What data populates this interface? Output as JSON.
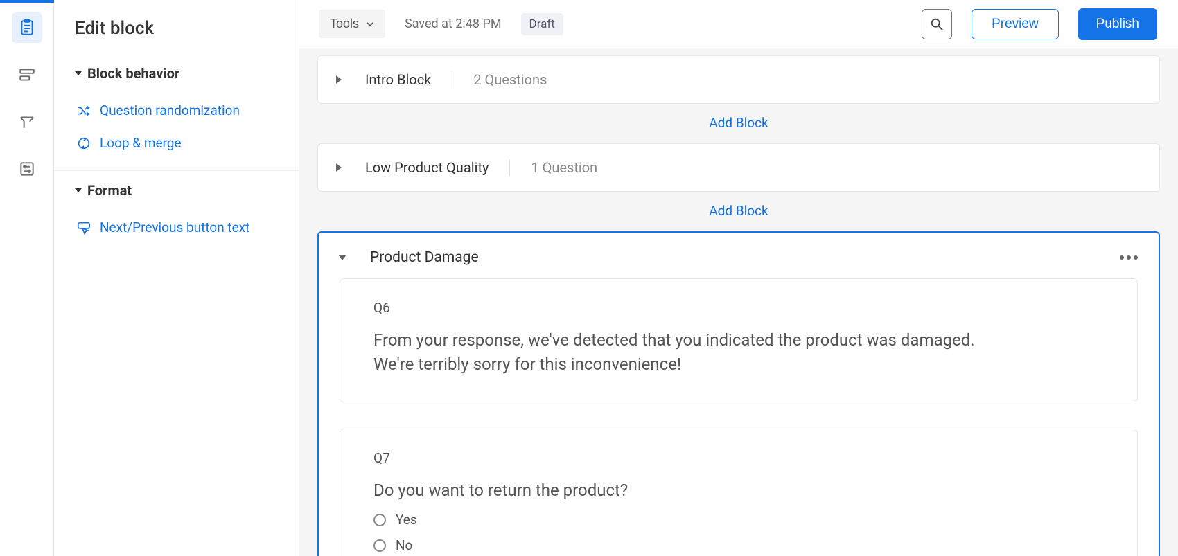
{
  "sidebar": {
    "title": "Edit block",
    "section_behavior": "Block behavior",
    "link_randomization": "Question randomization",
    "link_loopmerge": "Loop & merge",
    "section_format": "Format",
    "link_nav_buttons": "Next/Previous button text"
  },
  "topbar": {
    "tools": "Tools",
    "saved": "Saved at 2:48 PM",
    "draft": "Draft",
    "preview": "Preview",
    "publish": "Publish"
  },
  "canvas": {
    "add_block": "Add Block",
    "blocks": [
      {
        "title": "Intro Block",
        "meta": "2 Questions"
      },
      {
        "title": "Low Product Quality",
        "meta": "1 Question"
      }
    ],
    "active_block": {
      "title": "Product Damage",
      "q6": {
        "id": "Q6",
        "text": "From your response, we've detected that you indicated the product was damaged. We're terribly sorry for this inconvenience!"
      },
      "q7": {
        "id": "Q7",
        "text": "Do you want to return the product?",
        "opt1": "Yes",
        "opt2": "No"
      }
    }
  }
}
